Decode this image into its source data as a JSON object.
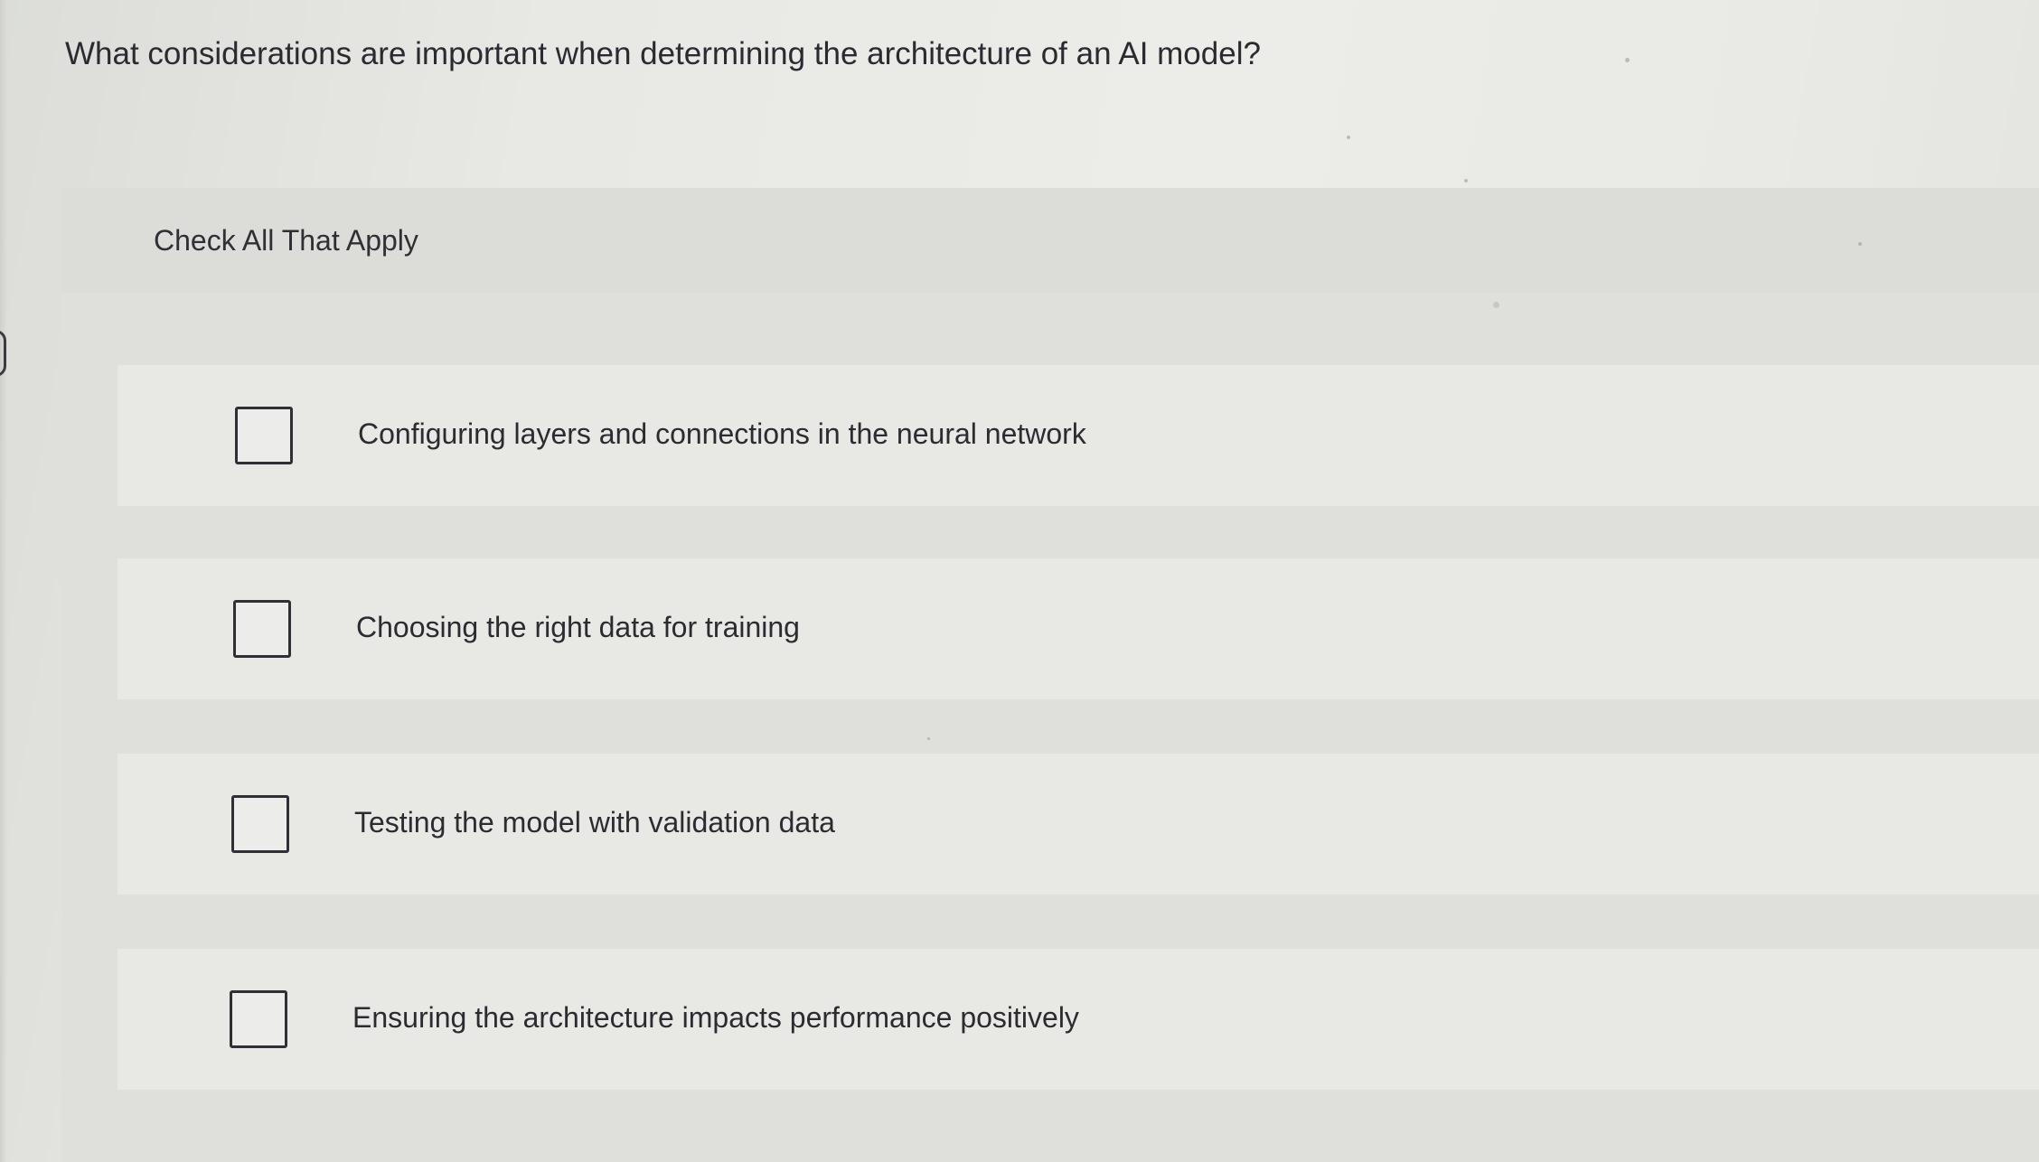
{
  "question": {
    "text": "What considerations are important when determining the architecture of an AI model?"
  },
  "instruction": {
    "text": "Check All That Apply"
  },
  "options": [
    {
      "label": "Configuring layers and connections in the neural network",
      "checked": false
    },
    {
      "label": "Choosing the right data for training",
      "checked": false
    },
    {
      "label": "Testing the model with validation data",
      "checked": false
    },
    {
      "label": "Ensuring the architecture impacts performance positively",
      "checked": false
    }
  ],
  "colors": {
    "text": "#2b2c30",
    "panel": "#dfe0dc",
    "option_background": "#e8e8e4",
    "checkbox_border": "#2f3035"
  }
}
